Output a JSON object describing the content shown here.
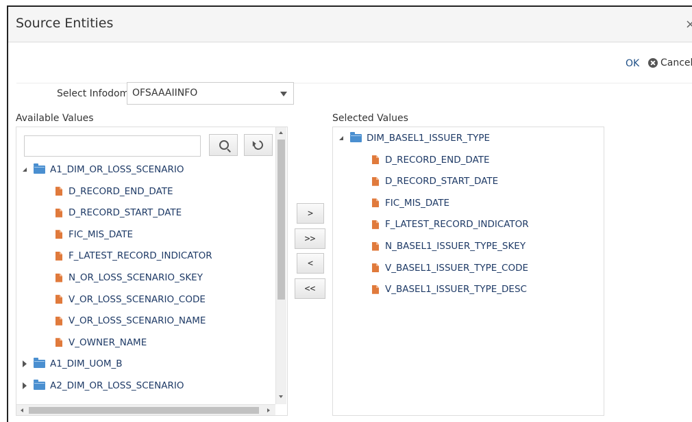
{
  "dialog": {
    "title": "Source Entities",
    "close_glyph": "×",
    "ok_label": "OK",
    "cancel_label": "Cancel"
  },
  "infodom": {
    "label": "Select Infodom",
    "value": "OFSAAAIINFO"
  },
  "available": {
    "label": "Available Values",
    "search_placeholder": "",
    "tree": [
      {
        "label": "A1_DIM_OR_LOSS_SCENARIO",
        "type": "folder",
        "expanded": true
      },
      {
        "label": "D_RECORD_END_DATE",
        "type": "file"
      },
      {
        "label": "D_RECORD_START_DATE",
        "type": "file"
      },
      {
        "label": "FIC_MIS_DATE",
        "type": "file"
      },
      {
        "label": "F_LATEST_RECORD_INDICATOR",
        "type": "file"
      },
      {
        "label": "N_OR_LOSS_SCENARIO_SKEY",
        "type": "file"
      },
      {
        "label": "V_OR_LOSS_SCENARIO_CODE",
        "type": "file"
      },
      {
        "label": "V_OR_LOSS_SCENARIO_NAME",
        "type": "file"
      },
      {
        "label": "V_OWNER_NAME",
        "type": "file"
      },
      {
        "label": "A1_DIM_UOM_B",
        "type": "folder",
        "expanded": false
      },
      {
        "label": "A2_DIM_OR_LOSS_SCENARIO",
        "type": "folder",
        "expanded": false
      }
    ]
  },
  "shuttle": {
    "move": ">",
    "move_all": ">>",
    "remove": "<",
    "remove_all": "<<"
  },
  "selected": {
    "label": "Selected Values",
    "tree": [
      {
        "label": "DIM_BASEL1_ISSUER_TYPE",
        "type": "folder",
        "expanded": true
      },
      {
        "label": "D_RECORD_END_DATE",
        "type": "file"
      },
      {
        "label": "D_RECORD_START_DATE",
        "type": "file"
      },
      {
        "label": "FIC_MIS_DATE",
        "type": "file"
      },
      {
        "label": "F_LATEST_RECORD_INDICATOR",
        "type": "file"
      },
      {
        "label": "N_BASEL1_ISSUER_TYPE_SKEY",
        "type": "file"
      },
      {
        "label": "V_BASEL1_ISSUER_TYPE_CODE",
        "type": "file"
      },
      {
        "label": "V_BASEL1_ISSUER_TYPE_DESC",
        "type": "file"
      }
    ]
  },
  "colors": {
    "link_blue": "#1e4f86",
    "tree_text": "#1e3a66",
    "folder_blue": "#4a8fd0",
    "file_orange": "#e07a3c"
  }
}
